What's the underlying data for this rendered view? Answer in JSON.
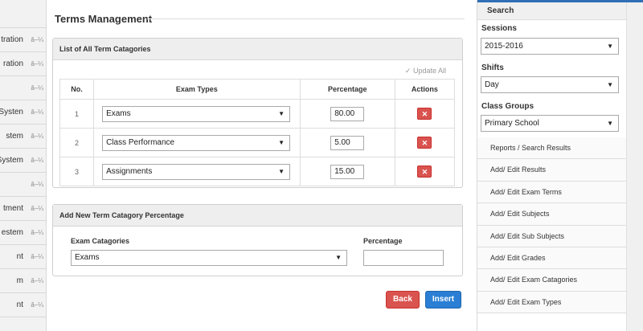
{
  "left_sidebar": {
    "items": [
      {
        "label": "",
        "arrow": ""
      },
      {
        "label": "tration",
        "arrow": "â–¼"
      },
      {
        "label": "ration",
        "arrow": "â–¼"
      },
      {
        "label": "",
        "arrow": "â–¼"
      },
      {
        "label": "ce Systen",
        "arrow": "â–¼"
      },
      {
        "label": "stem",
        "arrow": "â–¼"
      },
      {
        "label": "System",
        "arrow": "â–¼"
      },
      {
        "label": "",
        "arrow": "â–¼"
      },
      {
        "label": "tment",
        "arrow": "â–¼"
      },
      {
        "label": "estem",
        "arrow": "â–¼"
      },
      {
        "label": "nt",
        "arrow": "â–¼"
      },
      {
        "label": "m",
        "arrow": "â–¼"
      },
      {
        "label": "nt",
        "arrow": "â–¼"
      }
    ]
  },
  "main": {
    "title": "Terms Management",
    "terms_panel": {
      "heading": "List of All Term Catagories",
      "update_all": "✓ Update All",
      "columns": [
        "No.",
        "Exam Types",
        "Percentage",
        "Actions"
      ],
      "rows": [
        {
          "no": "1",
          "exam_type": "Exams",
          "percentage": "80.00"
        },
        {
          "no": "2",
          "exam_type": "Class Performance",
          "percentage": "5.00"
        },
        {
          "no": "3",
          "exam_type": "Assignments",
          "percentage": "15.00"
        }
      ],
      "delete_glyph": "✕"
    },
    "add_panel": {
      "heading": "Add New Term Catagory Percentage",
      "exam_catagories_label": "Exam Catagories",
      "exam_catagories_value": "Exams",
      "percentage_label": "Percentage",
      "percentage_value": ""
    },
    "back_label": "Back",
    "insert_label": "Insert"
  },
  "right_sidebar": {
    "search_title": "Search",
    "sessions_label": "Sessions",
    "sessions_value": "2015-2016",
    "shifts_label": "Shifts",
    "shifts_value": "Day",
    "class_groups_label": "Class Groups",
    "class_groups_value": "Primary School",
    "links": [
      "Reports / Search Results",
      "Add/ Edit Results",
      "Add/ Edit Exam Terms",
      "Add/ Edit Subjects",
      "Add/ Edit Sub Subjects",
      "Add/ Edit Grades",
      "Add/ Edit Exam Catagories",
      "Add/ Edit Exam Types"
    ]
  },
  "colors": {
    "danger": "#d9534f",
    "primary": "#2a7fd4",
    "accent_bar": "#2f6fb5"
  },
  "icons": {
    "caret": "▼"
  }
}
